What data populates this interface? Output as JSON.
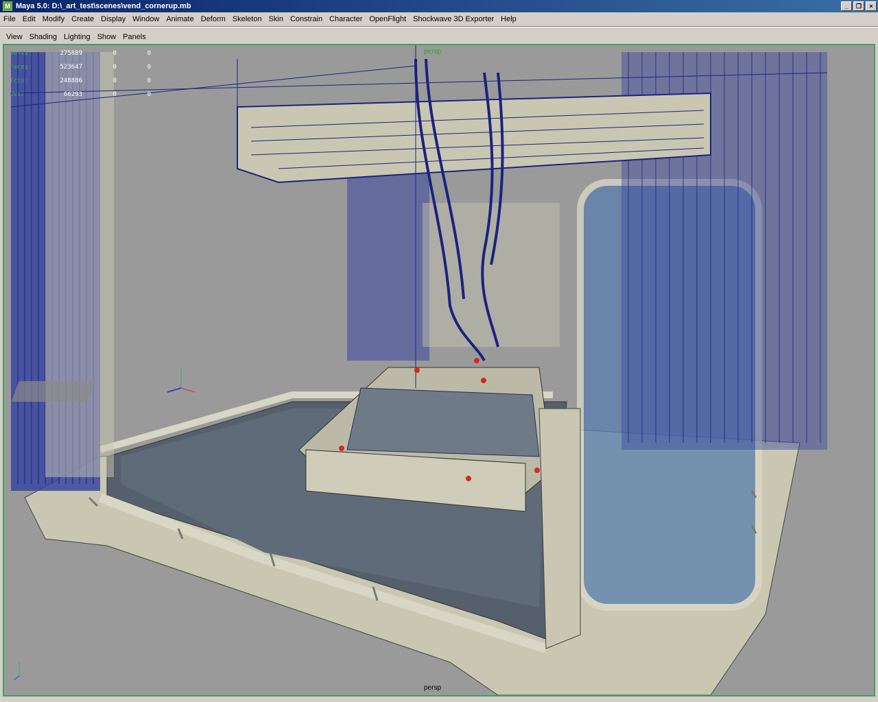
{
  "window": {
    "title": "Maya 5.0: D:\\_art_test\\scenes\\vend_cornerup.mb",
    "app_icon": "M",
    "buttons": [
      "minimize-icon",
      "restore-icon",
      "close-icon"
    ]
  },
  "menubar": {
    "items": [
      "File",
      "Edit",
      "Modify",
      "Create",
      "Display",
      "Window",
      "Animate",
      "Deform",
      "Skeleton",
      "Skin",
      "Constrain",
      "Character",
      "OpenFlight",
      "Shockwave 3D Exporter",
      "Help"
    ]
  },
  "panel_menu": {
    "items": [
      "View",
      "Shading",
      "Lighting",
      "Show",
      "Panels"
    ]
  },
  "hud": {
    "rows": [
      {
        "label": "Verts:",
        "v1": "275889",
        "v2": "0",
        "v3": "0"
      },
      {
        "label": "Faces:",
        "v1": "523647",
        "v2": "0",
        "v3": "0"
      },
      {
        "label": "Tris:",
        "v1": "248886",
        "v2": "0",
        "v3": "0"
      },
      {
        "label": "UVs:",
        "v1": "66293",
        "v2": "0",
        "v3": "0"
      }
    ]
  },
  "viewport": {
    "camera_label": "persp",
    "top_label": "persp",
    "colors": {
      "background": "#9a9a9a",
      "wireframe": "#1a237e",
      "surface": "#c9c7b2",
      "glass": "#5a7fb0",
      "floor": "#55606c",
      "marker": "#d62a1a",
      "border": "#3f9f5f"
    }
  }
}
